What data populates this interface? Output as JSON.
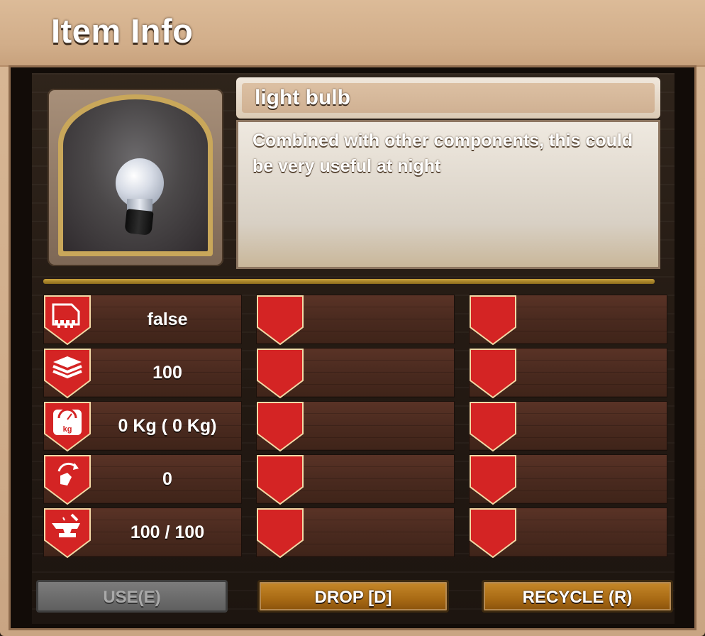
{
  "window": {
    "title": "Item Info"
  },
  "item": {
    "name": "light bulb",
    "description": "Combined with other components, this could be very useful at night",
    "icon": "light-bulb"
  },
  "stats": [
    {
      "icon": "spoil-icon",
      "value": "false"
    },
    {
      "icon": "stack-icon",
      "value": "100"
    },
    {
      "icon": "weight-icon",
      "value": "0 Kg ( 0 Kg)"
    },
    {
      "icon": "repair-icon",
      "value": "0"
    },
    {
      "icon": "anvil-icon",
      "value": "100 / 100"
    }
  ],
  "empty_slots_per_row": 2,
  "buttons": {
    "use": "USE(E)",
    "drop": "DROP [D]",
    "recycle": "RECYCLE (R)"
  },
  "colors": {
    "badge_red": "#d42424",
    "badge_border": "#f3d9a6",
    "button_orange": "#b8761d",
    "gold_rule": "#c9a13b"
  }
}
